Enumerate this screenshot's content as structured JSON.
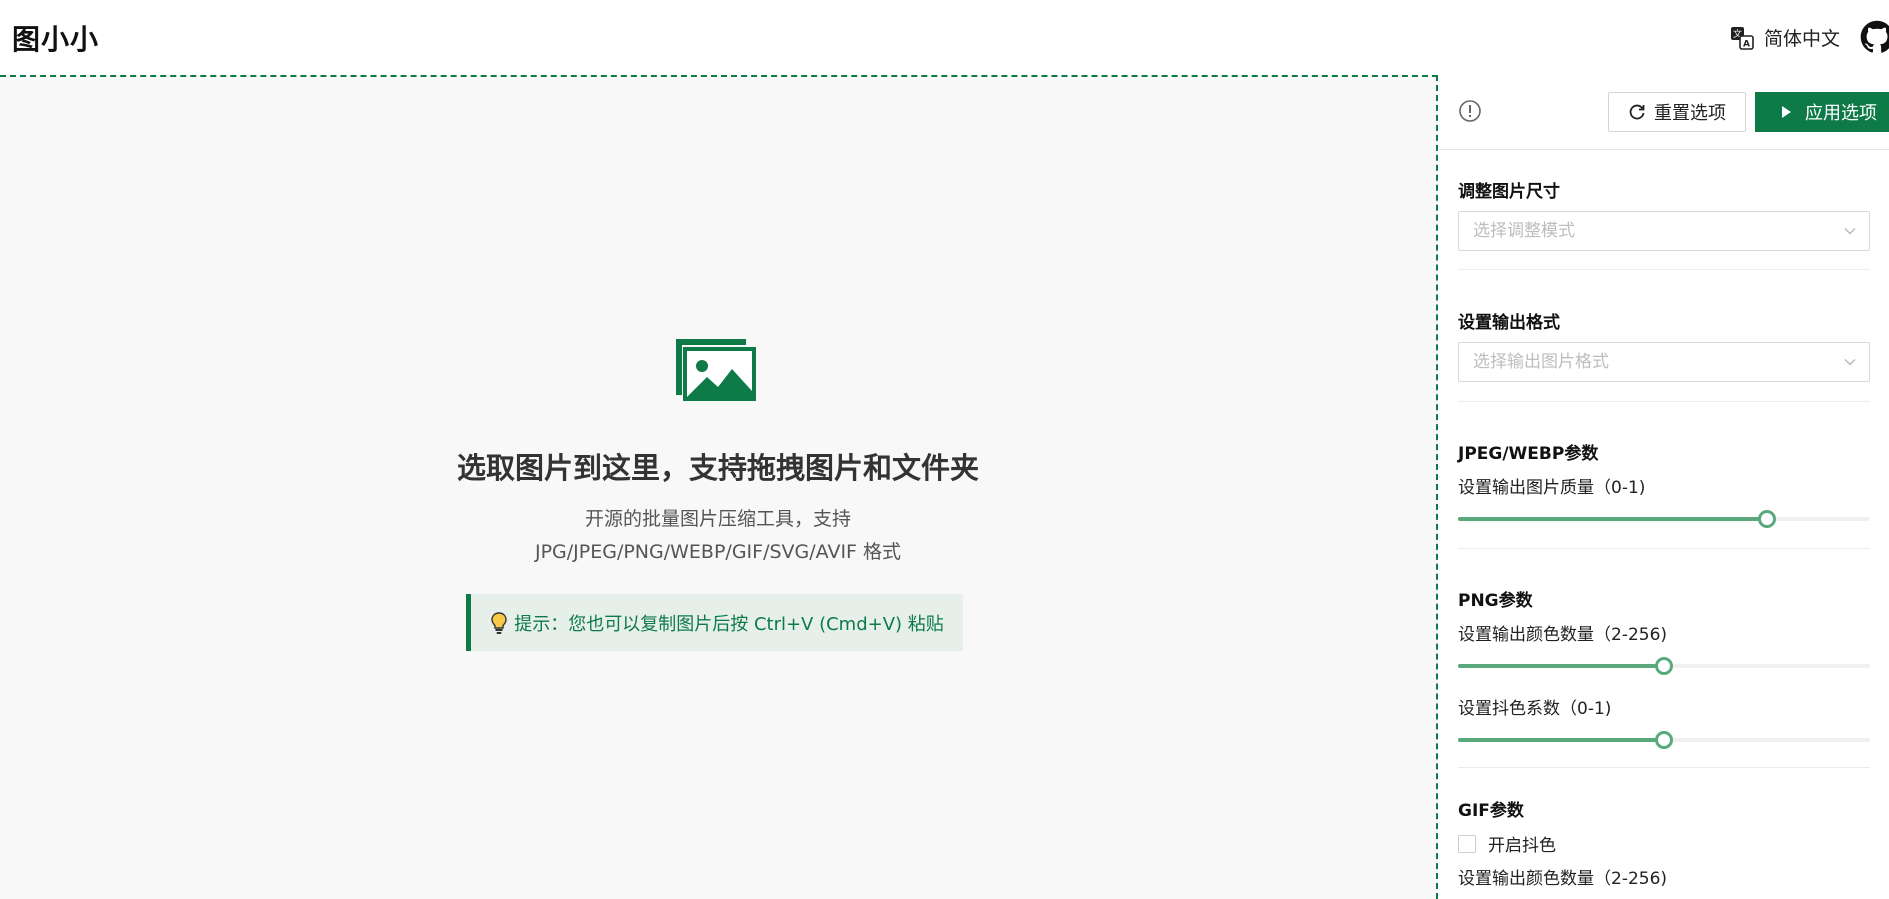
{
  "header": {
    "app_title": "图小小",
    "language": "简体中文"
  },
  "icons": {
    "translate": "translate-icon",
    "github": "github-icon",
    "picture": "picture-icon",
    "bulb": "bulb-icon",
    "info": "info-icon",
    "reset": "refresh-icon",
    "apply": "play-icon",
    "chevron": "chevron-down-icon"
  },
  "colors": {
    "accent": "#0e7a48",
    "slider": "#5aa97c",
    "tip_bg": "#e6efea",
    "drop_bg": "#f8f8f8"
  },
  "dropzone": {
    "title": "选取图片到这里，支持拖拽图片和文件夹",
    "subtitle_line1": "开源的批量图片压缩工具，支持",
    "subtitle_line2": "JPG/JPEG/PNG/WEBP/GIF/SVG/AVIF 格式",
    "tip": "提示：您也可以复制图片后按 Ctrl+V (Cmd+V) 粘贴"
  },
  "panel": {
    "reset_label": "重置选项",
    "apply_label": "应用选项",
    "resize": {
      "title": "调整图片尺寸",
      "placeholder": "选择调整模式"
    },
    "format": {
      "title": "设置输出格式",
      "placeholder": "选择输出图片格式"
    },
    "jpeg": {
      "title": "JPEG/WEBP参数",
      "quality_label": "设置输出图片质量（0-1)",
      "quality_value": 0.75
    },
    "png": {
      "title": "PNG参数",
      "colors_label": "设置输出颜色数量（2-256)",
      "colors_fraction": 0.5,
      "dither_label": "设置抖色系数（0-1)",
      "dither_value": 0.5
    },
    "gif": {
      "title": "GIF参数",
      "dither_checkbox": "开启抖色",
      "colors_label": "设置输出颜色数量（2-256)"
    }
  }
}
